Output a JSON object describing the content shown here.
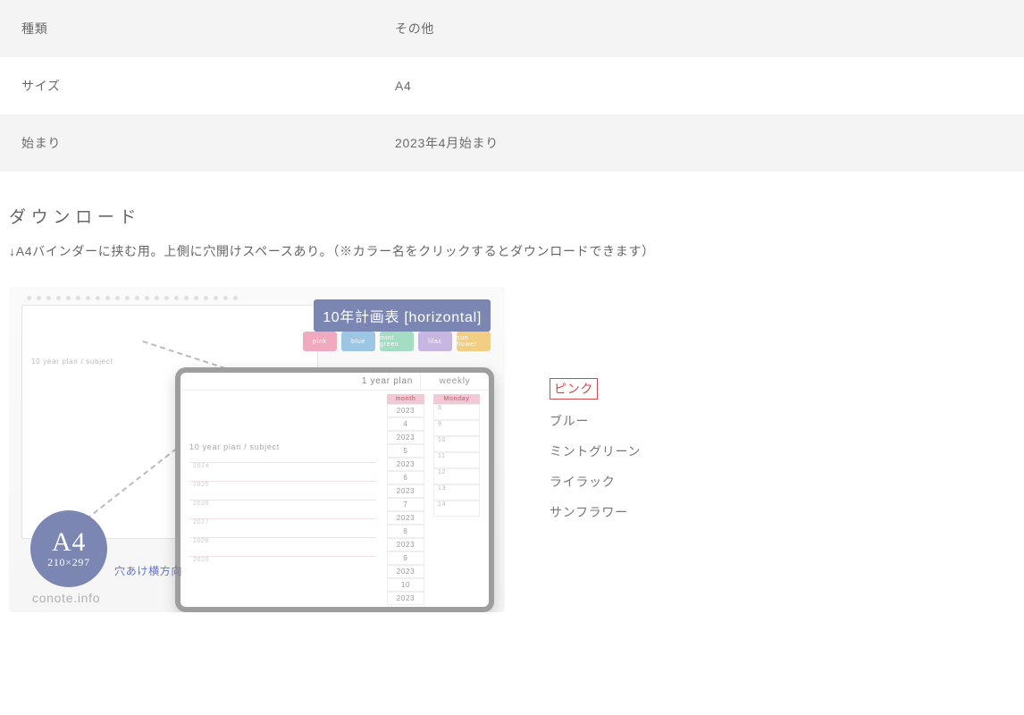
{
  "spec_table": {
    "rows": [
      {
        "label": "種類",
        "value": "その他"
      },
      {
        "label": "サイズ",
        "value": "A4"
      },
      {
        "label": "始まり",
        "value": "2023年4月始まり"
      }
    ]
  },
  "download": {
    "section_title": "ダウンロード",
    "description": "↓A4バインダーに挟む用。上側に穴開けスペースあり。（※カラー名をクリックするとダウンロードできます）"
  },
  "preview": {
    "banner": "10年計画表 [horizontal]",
    "chips": {
      "pink": "pink",
      "blue": "blue",
      "mint": "mint green",
      "lilac": "lilac",
      "sun": "sun flower"
    },
    "zoom": {
      "plan_title": "1 year plan",
      "weekly_title": "weekly",
      "subject_title": "10 year plan / subject",
      "year_header": "month",
      "weekly_header": "Monday",
      "years": [
        "2023",
        "4",
        "2023",
        "5",
        "2023",
        "6",
        "2023",
        "7",
        "2023",
        "8",
        "2023",
        "9",
        "2023",
        "10",
        "2023"
      ],
      "wk_cells": [
        "8",
        "9",
        "10",
        "11",
        "12",
        "13",
        "14"
      ],
      "plan_rows": [
        "2024",
        "2025",
        "2026",
        "2027",
        "2028",
        "2029"
      ]
    },
    "a4_badge": {
      "big": "A4",
      "small": "210×297"
    },
    "badge_note": "穴あけ横方向",
    "credit": "conote.info"
  },
  "color_links": [
    {
      "label": "ピンク",
      "highlight": true
    },
    {
      "label": "ブルー",
      "highlight": false
    },
    {
      "label": "ミントグリーン",
      "highlight": false
    },
    {
      "label": "ライラック",
      "highlight": false
    },
    {
      "label": "サンフラワー",
      "highlight": false
    }
  ]
}
